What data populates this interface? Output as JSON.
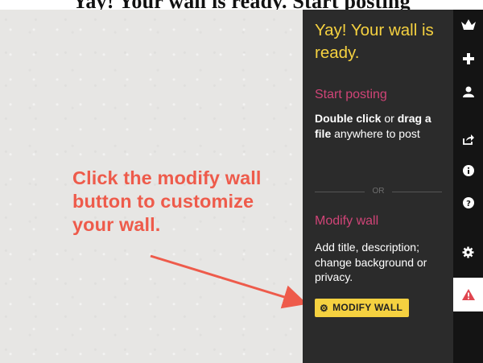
{
  "top_caption": "Yay! Your wall is ready. Start posting",
  "annotation": {
    "text": "Click the modify wall button to customize your wall.",
    "color": "#ee5b4b"
  },
  "panel": {
    "title": "Yay! Your wall is ready.",
    "start_heading": "Start posting",
    "start_text": {
      "part1": "Double click",
      "part2": " or ",
      "part3": "drag a file",
      "part4": " anywhere to post"
    },
    "or_label": "OR",
    "modify_heading": "Modify wall",
    "modify_text": "Add title, description; change background or privacy.",
    "modify_button_label": "MODIFY WALL"
  },
  "sidebar_icons": [
    "padlet-logo-icon",
    "plus-icon",
    "user-icon",
    "share-icon",
    "info-icon",
    "help-icon",
    "gear-icon",
    "alert-icon"
  ],
  "colors": {
    "accent_yellow": "#f5d140",
    "heading_pink": "#d04477",
    "panel_bg": "#2b2b2b",
    "icon_bar_bg": "#141414",
    "alert_red": "#e0454f"
  }
}
